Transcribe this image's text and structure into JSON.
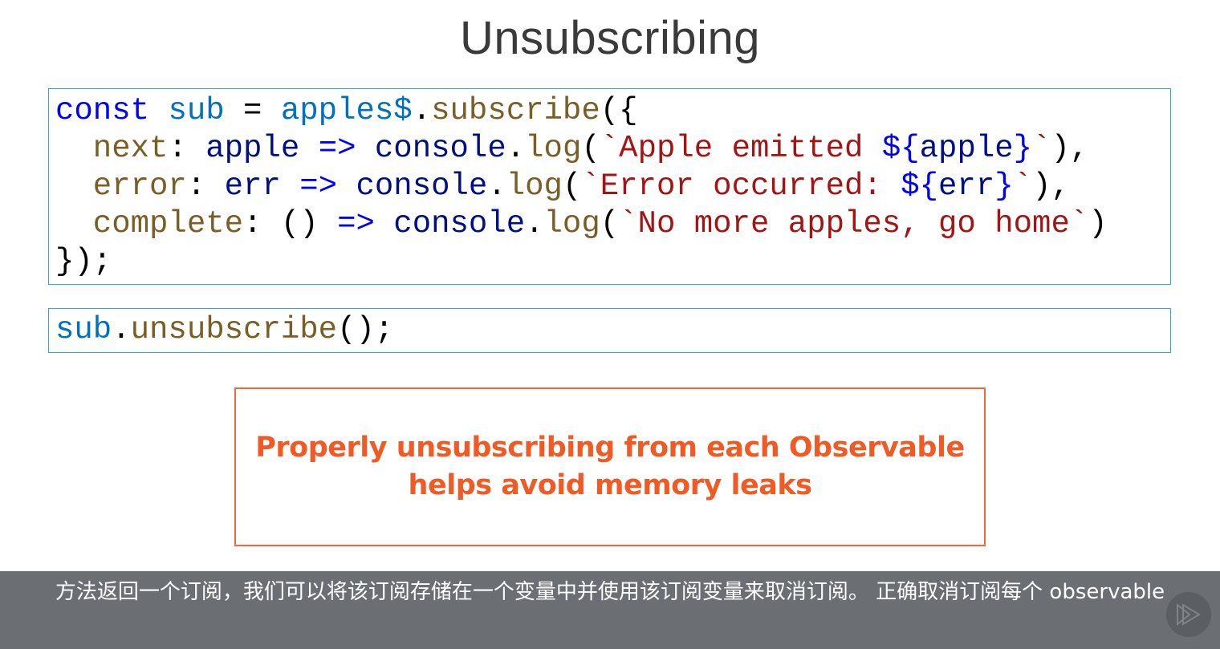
{
  "slide": {
    "title": "Unsubscribing"
  },
  "code_block_1": {
    "lines": [
      [
        [
          "const",
          "kw"
        ],
        [
          " ",
          "punc"
        ],
        [
          "sub",
          "var"
        ],
        [
          " = ",
          "punc"
        ],
        [
          "apples$",
          "var"
        ],
        [
          ".",
          "punc"
        ],
        [
          "subscribe",
          "fn"
        ],
        [
          "({",
          "punc"
        ]
      ],
      [
        [
          "  next",
          "fn"
        ],
        [
          ": ",
          "punc"
        ],
        [
          "apple",
          "param"
        ],
        [
          " ",
          "punc"
        ],
        [
          "=>",
          "kw"
        ],
        [
          " ",
          "punc"
        ],
        [
          "console",
          "param"
        ],
        [
          ".",
          "punc"
        ],
        [
          "log",
          "fn"
        ],
        [
          "(",
          "punc"
        ],
        [
          "`Apple emitted ",
          "str"
        ],
        [
          "${",
          "kw"
        ],
        [
          "apple",
          "param"
        ],
        [
          "}",
          "kw"
        ],
        [
          "`",
          "str"
        ],
        [
          "),",
          "punc"
        ]
      ],
      [
        [
          "  error",
          "fn"
        ],
        [
          ": ",
          "punc"
        ],
        [
          "err",
          "param"
        ],
        [
          " ",
          "punc"
        ],
        [
          "=>",
          "kw"
        ],
        [
          " ",
          "punc"
        ],
        [
          "console",
          "param"
        ],
        [
          ".",
          "punc"
        ],
        [
          "log",
          "fn"
        ],
        [
          "(",
          "punc"
        ],
        [
          "`Error occurred: ",
          "str"
        ],
        [
          "${",
          "kw"
        ],
        [
          "err",
          "param"
        ],
        [
          "}",
          "kw"
        ],
        [
          "`",
          "str"
        ],
        [
          "),",
          "punc"
        ]
      ],
      [
        [
          "  complete",
          "fn"
        ],
        [
          ": () ",
          "punc"
        ],
        [
          "=>",
          "kw"
        ],
        [
          " ",
          "punc"
        ],
        [
          "console",
          "param"
        ],
        [
          ".",
          "punc"
        ],
        [
          "log",
          "fn"
        ],
        [
          "(",
          "punc"
        ],
        [
          "`No more apples, go home`",
          "str"
        ],
        [
          ")",
          "punc"
        ]
      ],
      [
        [
          "});",
          "punc"
        ]
      ]
    ]
  },
  "code_block_2": {
    "lines": [
      [
        [
          "sub",
          "var"
        ],
        [
          ".",
          "punc"
        ],
        [
          "unsubscribe",
          "fn"
        ],
        [
          "();",
          "punc"
        ]
      ]
    ]
  },
  "callout": {
    "line1": "Properly unsubscribing from each Observable",
    "line2": "helps avoid memory leaks",
    "color": "#f05a24"
  },
  "subtitle": {
    "text": "方法返回一个订阅，我们可以将该订阅存储在一个变量中并使用该订阅变量来取消订阅。 正确取消订阅每个 observable"
  },
  "player": {
    "icon": "play-icon"
  }
}
